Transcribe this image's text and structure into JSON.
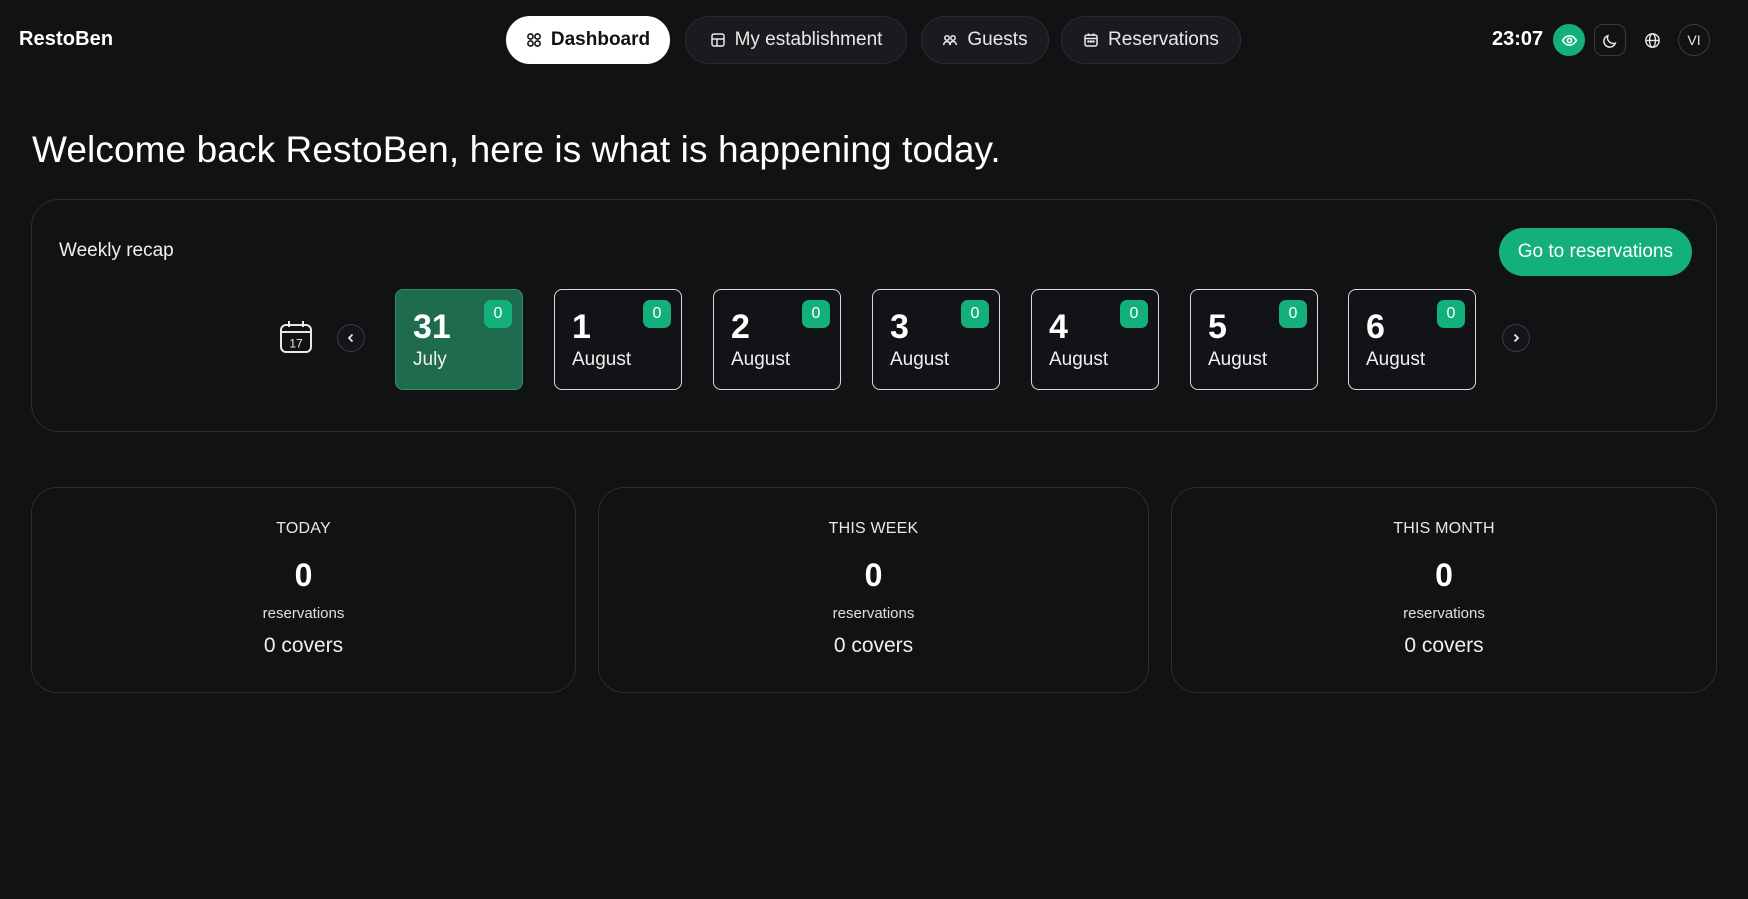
{
  "brand": "RestoBen",
  "nav": [
    {
      "label": "Dashboard",
      "icon": "grid-icon",
      "active": true
    },
    {
      "label": "My establishment",
      "icon": "building-icon",
      "active": false
    },
    {
      "label": "Guests",
      "icon": "users-icon",
      "active": false
    },
    {
      "label": "Reservations",
      "icon": "calendar-icon",
      "active": false
    }
  ],
  "header_tools": {
    "time": "23:07",
    "view_icon": "eye-icon",
    "theme_icon": "moon-icon",
    "language_icon": "globe-icon",
    "avatar_initials": "VI"
  },
  "headline": "Welcome back RestoBen, here is what is happening today.",
  "weekly_recap": {
    "title": "Weekly recap",
    "cta_label": "Go to reservations",
    "calendar_icon_day": "17",
    "days": [
      {
        "day": "31",
        "month": "July",
        "count": "0",
        "selected": true
      },
      {
        "day": "1",
        "month": "August",
        "count": "0",
        "selected": false
      },
      {
        "day": "2",
        "month": "August",
        "count": "0",
        "selected": false
      },
      {
        "day": "3",
        "month": "August",
        "count": "0",
        "selected": false
      },
      {
        "day": "4",
        "month": "August",
        "count": "0",
        "selected": false
      },
      {
        "day": "5",
        "month": "August",
        "count": "0",
        "selected": false
      },
      {
        "day": "6",
        "month": "August",
        "count": "0",
        "selected": false
      }
    ]
  },
  "stats": [
    {
      "label": "TODAY",
      "value": "0",
      "unit": "reservations",
      "covers": "0 covers"
    },
    {
      "label": "THIS WEEK",
      "value": "0",
      "unit": "reservations",
      "covers": "0 covers"
    },
    {
      "label": "THIS MONTH",
      "value": "0",
      "unit": "reservations",
      "covers": "0 covers"
    }
  ],
  "colors": {
    "background": "#111214",
    "accent": "#13b07c",
    "selected_day": "#1e6b4d"
  }
}
